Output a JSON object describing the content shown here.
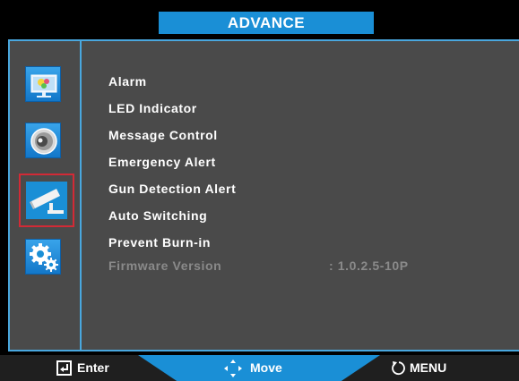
{
  "title": "ADVANCE",
  "sidebar": {
    "items": [
      {
        "icon": "picture-icon"
      },
      {
        "icon": "speaker-icon"
      },
      {
        "icon": "security-camera-icon"
      },
      {
        "icon": "gears-icon"
      }
    ],
    "selected_index": 2
  },
  "menu": {
    "items": [
      {
        "label": "Alarm"
      },
      {
        "label": "LED Indicator"
      },
      {
        "label": "Message Control"
      },
      {
        "label": "Emergency Alert"
      },
      {
        "label": "Gun Detection Alert"
      },
      {
        "label": "Auto Switching"
      },
      {
        "label": "Prevent Burn-in"
      },
      {
        "label": "Firmware Version",
        "value": ": 1.0.2.5-10P",
        "disabled": true
      }
    ]
  },
  "footer": {
    "enter_label": "Enter",
    "move_label": "Move",
    "menu_label": "MENU"
  },
  "colors": {
    "accent": "#1a8fd6",
    "frame": "#49a7de",
    "panel": "#4a4a4a",
    "selection": "#d22a36",
    "disabled_text": "#8a8a8a"
  }
}
